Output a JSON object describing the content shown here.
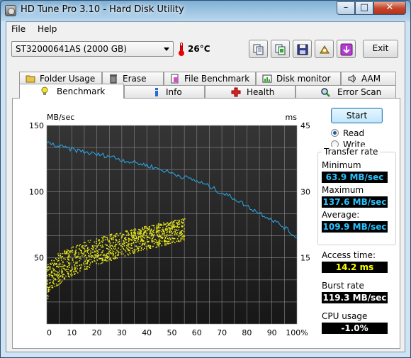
{
  "window": {
    "title": "HD Tune Pro 3.10 - Hard Disk Utility"
  },
  "menu": {
    "file": "File",
    "help": "Help"
  },
  "drive": {
    "selected": "ST32000641AS (2000 GB)"
  },
  "temperature": "26°C",
  "toolbar": {
    "exit_label": "Exit",
    "icons": [
      "copy-info-icon",
      "copy-screen-icon",
      "save-icon",
      "options-icon",
      "download-icon"
    ]
  },
  "tabs_top": [
    {
      "label": "Folder Usage",
      "icon": "folder-icon"
    },
    {
      "label": "Erase",
      "icon": "trash-icon"
    },
    {
      "label": "File Benchmark",
      "icon": "file-benchmark-icon"
    },
    {
      "label": "Disk monitor",
      "icon": "disk-monitor-icon"
    },
    {
      "label": "AAM",
      "icon": "speaker-icon"
    }
  ],
  "tabs_bottom": [
    {
      "label": "Benchmark",
      "icon": "benchmark-bulb-icon",
      "active": true
    },
    {
      "label": "Info",
      "icon": "info-icon"
    },
    {
      "label": "Health",
      "icon": "health-cross-icon"
    },
    {
      "label": "Error Scan",
      "icon": "error-scan-icon"
    }
  ],
  "controls": {
    "start_label": "Start",
    "read_label": "Read",
    "write_label": "Write",
    "mode_selected": "Read"
  },
  "transfer_rate": {
    "group_title": "Transfer rate",
    "minimum_label": "Minimum",
    "minimum_value": "63.9 MB/sec",
    "maximum_label": "Maximum",
    "maximum_value": "137.6 MB/sec",
    "average_label": "Average:",
    "average_value": "109.9 MB/sec"
  },
  "access_time": {
    "label": "Access time:",
    "value": "14.2 ms"
  },
  "burst_rate": {
    "label": "Burst rate",
    "value": "119.3 MB/sec"
  },
  "cpu_usage": {
    "label": "CPU usage",
    "value": "-1.0%"
  },
  "colors": {
    "transfer_line": "#29a3e0",
    "access_points": "#e8e81a",
    "chart_bg": "#1a1a1a",
    "grid": "#8a8a8a"
  },
  "chart_data": {
    "type": "line",
    "left_axis_label": "MB/sec",
    "right_axis_label": "ms",
    "left_ylim": [
      0,
      150
    ],
    "right_ylim": [
      0,
      45
    ],
    "left_ticks": [
      "150",
      "100",
      "50"
    ],
    "right_ticks": [
      "45",
      "30",
      "15"
    ],
    "x_ticks": [
      "0",
      "10",
      "20",
      "30",
      "40",
      "50",
      "60",
      "70",
      "80",
      "90",
      "100%"
    ],
    "xlim": [
      0,
      100
    ],
    "grid": true,
    "series": [
      {
        "name": "",
        "kind": "transfer_rate_line",
        "axis": "left",
        "x": [
          0,
          5,
          10,
          15,
          20,
          25,
          30,
          35,
          40,
          45,
          50,
          55,
          60,
          65,
          70,
          75,
          80,
          85,
          90,
          95,
          100
        ],
        "y": [
          137,
          134,
          132,
          130,
          128,
          127,
          124,
          122,
          120,
          117,
          114,
          111,
          108,
          104,
          99,
          95,
          89,
          84,
          79,
          73,
          65
        ]
      },
      {
        "name": "",
        "kind": "access_time_scatter",
        "axis": "right",
        "x_range": [
          0,
          55
        ],
        "y_min_at_start": [
          5,
          13
        ],
        "y_max_at_end": [
          19,
          24
        ],
        "count": 1200
      }
    ]
  }
}
